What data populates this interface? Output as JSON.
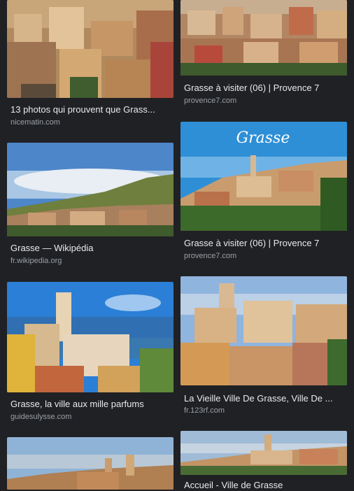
{
  "results": [
    {
      "title": "13 photos qui prouvent que Grass...",
      "source": "nicematin.com"
    },
    {
      "title": "Grasse à visiter (06) | Provence 7",
      "source": "provence7.com"
    },
    {
      "title": "Grasse — Wikipédia",
      "source": "fr.wikipedia.org"
    },
    {
      "title": "Grasse à visiter (06) | Provence 7",
      "source": "provence7.com",
      "overlay_text": "Grasse"
    },
    {
      "title": "Grasse, la ville aux mille parfums",
      "source": "guidesulysse.com"
    },
    {
      "title": "La Vieille Ville De Grasse, Ville De ...",
      "source": "fr.123rf.com"
    },
    {
      "title": "",
      "source": ""
    },
    {
      "title": "Accueil - Ville de Grasse",
      "source": ""
    }
  ],
  "colors": {
    "background": "#202124",
    "title_text": "#e8eaed",
    "source_text": "#9aa0a6"
  }
}
